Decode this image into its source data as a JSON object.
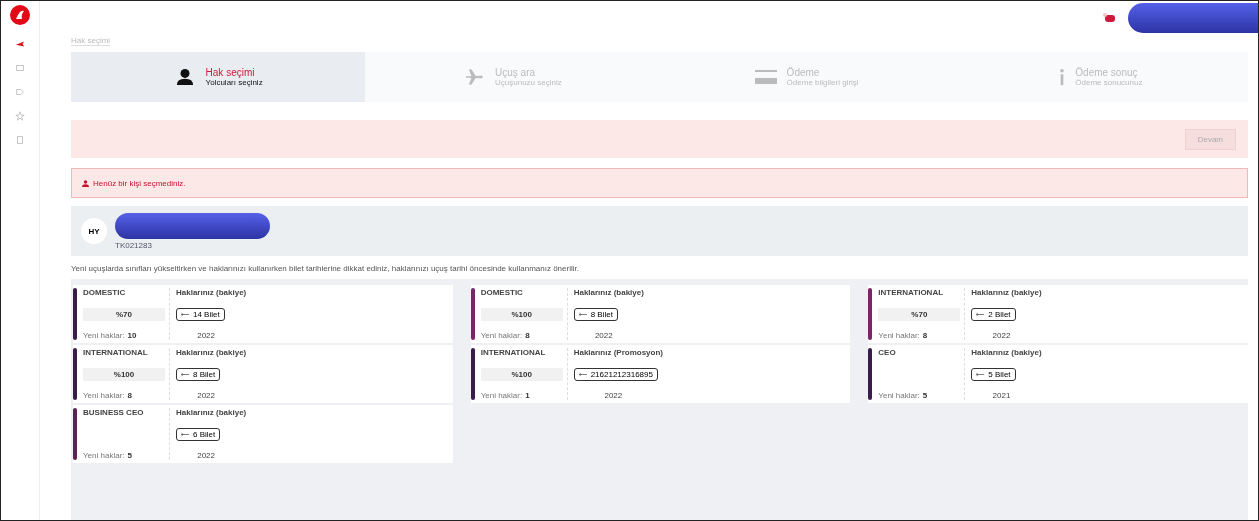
{
  "breadcrumb": "Hak seçimi",
  "steps": [
    {
      "title": "Hak seçimi",
      "subtitle": "Yolcuları seçiniz",
      "selected": true
    },
    {
      "title": "Uçuş ara",
      "subtitle": "Uçuşunuzu seçiniz",
      "selected": false
    },
    {
      "title": "Ödeme",
      "subtitle": "Ödeme bilgileri girişi",
      "selected": false
    },
    {
      "title": "Ödeme sonuç",
      "subtitle": "Ödeme sonucunuz",
      "selected": false
    }
  ],
  "continue_button": "Devam",
  "alert": "Henüz bir kişi seçmediniz.",
  "profile": {
    "initials": "HY",
    "code": "TK021283"
  },
  "notice": "Yeni uçuşlarda sınıfları yükseltirken ve haklarınızı kullanırken bilet tarihlerine dikkat ediniz, haklarınızı uçuş tarihi öncesinde kullanmanız önerilir.",
  "columns": [
    [
      {
        "category": "DOMESTIC",
        "percent": "%70",
        "remaining": "Yeni haklar:",
        "count": "10",
        "rights_label": "Haklarınız (bakiye)",
        "ticket": "14 Bilet",
        "year": "2022",
        "color": "#3b1d4a"
      },
      {
        "category": "INTERNATIONAL",
        "percent": "%100",
        "remaining": "Yeni haklar:",
        "count": "8",
        "rights_label": "Haklarınız (bakiye)",
        "ticket": "8 Bilet",
        "year": "2022",
        "color": "#3b1d4a"
      },
      {
        "category": "BUSINESS CEO",
        "remaining": "Yeni haklar:",
        "count": "5",
        "rights_label": "Haklarınız (bakiye)",
        "ticket": "6 Bilet",
        "year": "2022",
        "color": "#5e2150"
      }
    ],
    [
      {
        "category": "DOMESTIC",
        "percent": "%100",
        "remaining": "Yeni haklar:",
        "count": "8",
        "rights_label": "Haklarınız (bakiye)",
        "ticket": "8 Bilet",
        "year": "2022",
        "color": "#7a2566"
      },
      {
        "category": "INTERNATIONAL",
        "percent": "%100",
        "remaining": "Yeni haklar:",
        "count": "1",
        "rights_label": "Haklarınız (Promosyon)",
        "ticket": "21621212316895",
        "year": "2022",
        "color": "#3b1d4a"
      }
    ],
    [
      {
        "category": "INTERNATIONAL",
        "percent": "%70",
        "remaining": "Yeni haklar:",
        "count": "8",
        "rights_label": "Haklarınız (bakiye)",
        "ticket": "2 Bilet",
        "year": "2022",
        "color": "#7a2566"
      },
      {
        "category": "CEO",
        "remaining": "Yeni haklar:",
        "count": "5",
        "rights_label": "Haklarınız (bakiye)",
        "ticket": "5 Bilet",
        "year": "2021",
        "color": "#3b1d4a"
      }
    ]
  ]
}
